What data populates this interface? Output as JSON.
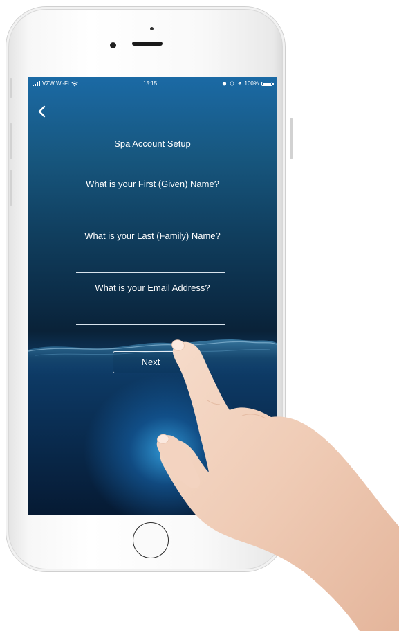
{
  "status_bar": {
    "carrier": "VZW Wi-Fi",
    "time": "15:15",
    "battery": "100%"
  },
  "screen": {
    "title": "Spa Account Setup",
    "questions": [
      "What is your First (Given) Name?",
      "What is your Last (Family) Name?",
      "What is your Email Address?"
    ],
    "fields": [
      "",
      "",
      ""
    ],
    "next_label": "Next"
  },
  "colors": {
    "water_top": "#1b6aa5",
    "water_deep": "#0a2238",
    "glow": "#37aaeb",
    "text": "#ffffff"
  },
  "icons": {
    "back": "chevron-left-icon",
    "wifi": "wifi-icon",
    "alarm": "alarm-icon",
    "location": "location-arrow-icon",
    "battery": "battery-icon"
  }
}
